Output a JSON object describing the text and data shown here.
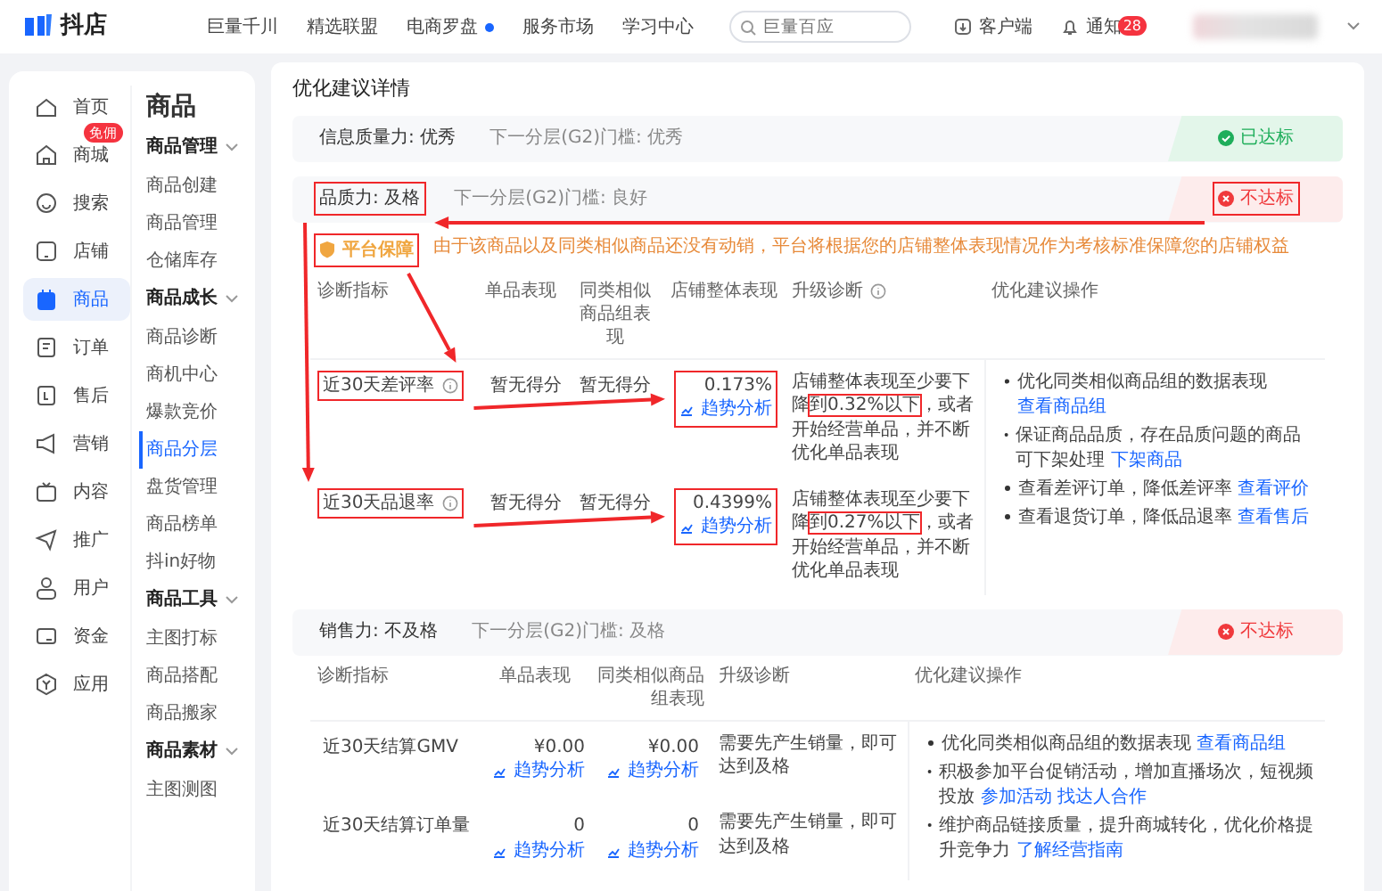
{
  "topbar": {
    "logo": "抖店",
    "nav": [
      {
        "label": "巨量千川",
        "dot": false
      },
      {
        "label": "精选联盟",
        "dot": false
      },
      {
        "label": "电商罗盘",
        "dot": true
      },
      {
        "label": "服务市场",
        "dot": false
      },
      {
        "label": "学习中心",
        "dot": false
      }
    ],
    "search": {
      "placeholder": "巨量百应"
    },
    "client": "客户端",
    "notice": {
      "label": "通知",
      "count": "28"
    }
  },
  "sidebar": {
    "items": [
      {
        "label": "首页",
        "selected": false
      },
      {
        "label": "商城",
        "selected": false,
        "badge": "免佣"
      },
      {
        "label": "搜索",
        "selected": false
      },
      {
        "label": "店铺",
        "selected": false
      },
      {
        "label": "商品",
        "selected": true
      },
      {
        "label": "订单",
        "selected": false
      },
      {
        "label": "售后",
        "selected": false
      },
      {
        "label": "营销",
        "selected": false
      },
      {
        "label": "内容",
        "selected": false
      },
      {
        "label": "推广",
        "selected": false
      },
      {
        "label": "用户",
        "selected": false
      },
      {
        "label": "资金",
        "selected": false
      },
      {
        "label": "应用",
        "selected": false
      }
    ]
  },
  "submenu": {
    "title": "商品",
    "groups": [
      {
        "label": "商品管理",
        "expanded": true,
        "children": [
          {
            "label": "商品创建",
            "selected": false
          },
          {
            "label": "商品管理",
            "selected": false
          },
          {
            "label": "仓储库存",
            "selected": false
          }
        ]
      },
      {
        "label": "商品成长",
        "expanded": true,
        "children": [
          {
            "label": "商品诊断",
            "selected": false
          },
          {
            "label": "商机中心",
            "selected": false
          },
          {
            "label": "爆款竞价",
            "selected": false
          },
          {
            "label": "商品分层",
            "selected": true
          },
          {
            "label": "盘货管理",
            "selected": false
          },
          {
            "label": "商品榜单",
            "selected": false
          },
          {
            "label": "抖in好物",
            "selected": false
          }
        ]
      },
      {
        "label": "商品工具",
        "expanded": true,
        "children": [
          {
            "label": "主图打标",
            "selected": false
          },
          {
            "label": "商品搭配",
            "selected": false
          },
          {
            "label": "商品搬家",
            "selected": false
          }
        ]
      },
      {
        "label": "商品素材",
        "expanded": true,
        "children": [
          {
            "label": "主图测图",
            "selected": false
          }
        ]
      }
    ]
  },
  "main": {
    "title": "优化建议详情",
    "sections": [
      {
        "label": "信息质量力: 优秀",
        "threshold": "下一分层(G2)门槛: 优秀",
        "status": "已达标",
        "met": true,
        "highlighted": false,
        "status_highlighted": false
      },
      {
        "label": "品质力: 及格",
        "threshold": "下一分层(G2)门槛: 良好",
        "status": "不达标",
        "met": false,
        "highlighted": true,
        "status_highlighted": true,
        "notice": {
          "tag": "平台保障",
          "text": "由于该商品以及同类相似商品还没有动销，平台将根据您的店铺整体表现情况作为考核标准保障您的店铺权益",
          "highlighted": true
        },
        "table": {
          "columns": [
            {
              "label": "诊断指标",
              "info": false
            },
            {
              "label": "单品表现",
              "info": false
            },
            {
              "label": "同类相似商品组表现",
              "info": false
            },
            {
              "label": "店铺整体表现",
              "info": false
            },
            {
              "label": "升级诊断",
              "info": true
            },
            {
              "label": "优化建议操作",
              "info": false
            }
          ],
          "rows": [
            {
              "cells": [
                {
                  "kind": "metric",
                  "text": "近30天差评率",
                  "info": true,
                  "highlighted": true
                },
                {
                  "kind": "value",
                  "text": "暂无得分",
                  "highlighted": false
                },
                {
                  "kind": "value",
                  "text": "暂无得分",
                  "highlighted": false
                },
                {
                  "kind": "value",
                  "text": "0.173%",
                  "link": "趋势分析",
                  "highlighted": true
                },
                {
                  "kind": "diagnosis",
                  "parts": [
                    {
                      "text": "店铺整体表现至少要下降",
                      "marked": false
                    },
                    {
                      "text": "到0.32%以下",
                      "marked": true
                    },
                    {
                      "text": "，或者开始经营单品，并不断优化单品表现",
                      "marked": false
                    }
                  ]
                }
              ]
            },
            {
              "cells": [
                {
                  "kind": "metric",
                  "text": "近30天品退率",
                  "info": true,
                  "highlighted": true
                },
                {
                  "kind": "value",
                  "text": "暂无得分",
                  "highlighted": false
                },
                {
                  "kind": "value",
                  "text": "暂无得分",
                  "highlighted": false
                },
                {
                  "kind": "value",
                  "text": "0.4399%",
                  "link": "趋势分析",
                  "highlighted": true
                },
                {
                  "kind": "diagnosis",
                  "parts": [
                    {
                      "text": "店铺整体表现至少要下降",
                      "marked": false
                    },
                    {
                      "text": "到0.27%以下",
                      "marked": true
                    },
                    {
                      "text": "，或者开始经营单品，并不断优化单品表现",
                      "marked": false
                    }
                  ]
                }
              ]
            }
          ],
          "suggestions": [
            {
              "text": "优化同类相似商品组的数据表现",
              "links": [
                "查看商品组"
              ]
            },
            {
              "text": "保证商品品质，存在品质问题的商品可下架处理",
              "links": [
                "下架商品"
              ]
            },
            {
              "text": "查看差评订单，降低差评率",
              "links": [
                "查看评价"
              ]
            },
            {
              "text": "查看退货订单，降低品退率",
              "links": [
                "查看售后"
              ]
            }
          ]
        }
      },
      {
        "label": "销售力: 不及格",
        "threshold": "下一分层(G2)门槛: 及格",
        "status": "不达标",
        "met": false,
        "highlighted": false,
        "status_highlighted": false,
        "table": {
          "columns": [
            {
              "label": "诊断指标",
              "info": false
            },
            {
              "label": "单品表现",
              "info": false
            },
            {
              "label": "同类相似商品组表现",
              "info": false
            },
            {
              "label": "升级诊断",
              "info": false
            },
            {
              "label": "优化建议操作",
              "info": false
            }
          ],
          "rows": [
            {
              "cells": [
                {
                  "kind": "metric",
                  "text": "近30天结算GMV",
                  "info": false,
                  "highlighted": false
                },
                {
                  "kind": "value",
                  "text": "¥0.00",
                  "link": "趋势分析",
                  "highlighted": false
                },
                {
                  "kind": "value",
                  "text": "¥0.00",
                  "link": "趋势分析",
                  "highlighted": false
                },
                {
                  "kind": "diagnosis",
                  "parts": [
                    {
                      "text": "需要先产生销量，即可达到及格",
                      "marked": false
                    }
                  ]
                }
              ]
            },
            {
              "cells": [
                {
                  "kind": "metric",
                  "text": "近30天结算订单量",
                  "info": false,
                  "highlighted": false
                },
                {
                  "kind": "value",
                  "text": "0",
                  "link": "趋势分析",
                  "highlighted": false
                },
                {
                  "kind": "value",
                  "text": "0",
                  "link": "趋势分析",
                  "highlighted": false
                },
                {
                  "kind": "diagnosis",
                  "parts": [
                    {
                      "text": "需要先产生销量，即可达到及格",
                      "marked": false
                    }
                  ]
                }
              ]
            }
          ],
          "suggestions": [
            {
              "text": "优化同类相似商品组的数据表现",
              "links": [
                "查看商品组"
              ]
            },
            {
              "text": "积极参加平台促销活动，增加直播场次，短视频投放",
              "links": [
                "参加活动",
                "找达人合作"
              ]
            },
            {
              "text": "维护商品链接质量，提升商城转化，优化价格提升竞争力",
              "links": [
                "了解经营指南"
              ]
            }
          ]
        }
      }
    ]
  }
}
